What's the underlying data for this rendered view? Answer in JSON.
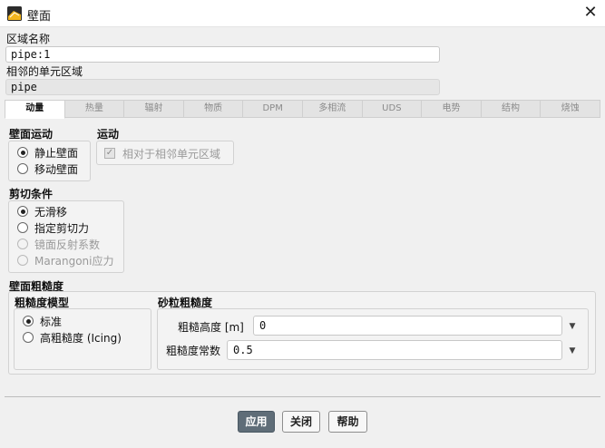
{
  "window": {
    "title": "壁面",
    "icon": "app-logo-icon",
    "close_icon": "close-icon",
    "close_glyph": "✕"
  },
  "zone_name": {
    "label": "区域名称",
    "value": "pipe:1"
  },
  "adjacent_zone": {
    "label": "相邻的单元区域",
    "value": "pipe"
  },
  "tabs": [
    {
      "label": "动量",
      "active": true
    },
    {
      "label": "热量",
      "active": false
    },
    {
      "label": "辐射",
      "active": false
    },
    {
      "label": "物质",
      "active": false
    },
    {
      "label": "DPM",
      "active": false
    },
    {
      "label": "多相流",
      "active": false
    },
    {
      "label": "UDS",
      "active": false
    },
    {
      "label": "电势",
      "active": false
    },
    {
      "label": "结构",
      "active": false
    },
    {
      "label": "烧蚀",
      "active": false
    }
  ],
  "wall_motion": {
    "title": "壁面运动",
    "options": [
      {
        "label": "静止壁面",
        "selected": true
      },
      {
        "label": "移动壁面",
        "selected": false
      }
    ]
  },
  "motion": {
    "title": "运动",
    "checkbox_label": "相对于相邻单元区域",
    "checked": true,
    "check_glyph": "✓"
  },
  "shear_condition": {
    "title": "剪切条件",
    "options": [
      {
        "label": "无滑移",
        "selected": true,
        "enabled": true
      },
      {
        "label": "指定剪切力",
        "selected": false,
        "enabled": true
      },
      {
        "label": "镜面反射系数",
        "selected": false,
        "enabled": false
      },
      {
        "label": "Marangoni应力",
        "selected": false,
        "enabled": false
      }
    ]
  },
  "wall_roughness": {
    "title": "壁面粗糙度",
    "model": {
      "title": "粗糙度模型",
      "options": [
        {
          "label": "标准",
          "selected": true
        },
        {
          "label": "高粗糙度 (Icing)",
          "selected": false
        }
      ]
    },
    "sand_grain": {
      "title": "砂粒粗糙度",
      "height": {
        "label": "粗糙高度 [m]",
        "value": "0"
      },
      "constant": {
        "label": "粗糙度常数",
        "value": "0.5"
      },
      "dropdown_glyph": "▼"
    }
  },
  "buttons": {
    "apply": "应用",
    "close": "关闭",
    "help": "帮助"
  }
}
